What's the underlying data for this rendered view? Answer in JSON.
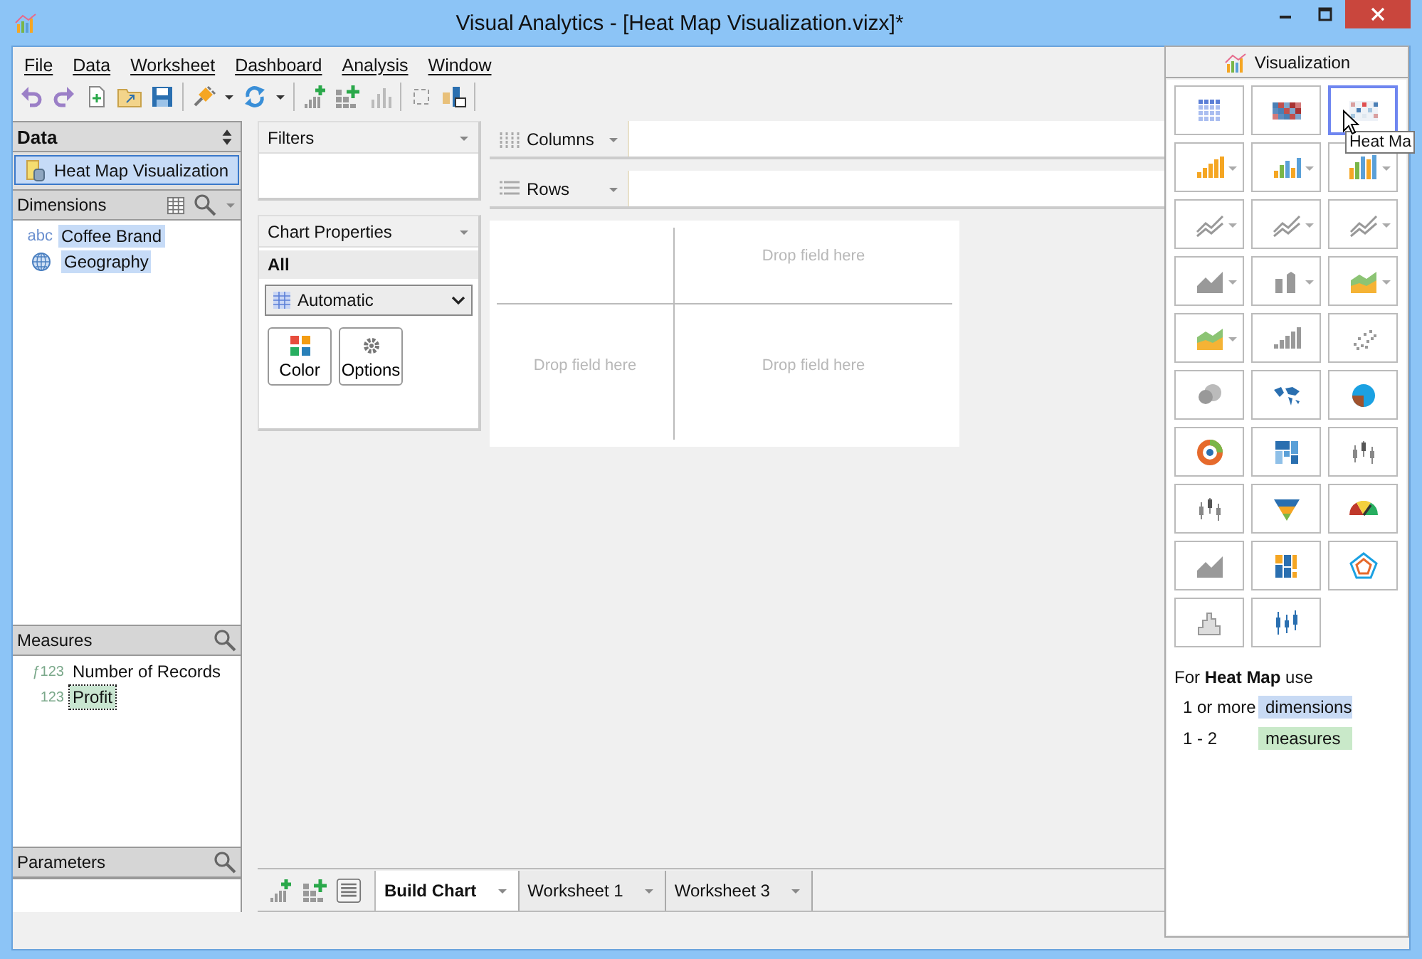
{
  "window": {
    "title": "Visual Analytics - [Heat Map Visualization.vizx]*"
  },
  "menu": [
    "File",
    "Data",
    "Worksheet",
    "Dashboard",
    "Analysis",
    "Window"
  ],
  "data_panel": {
    "title": "Data",
    "source": {
      "label": "Heat Map Visualization",
      "selected": true
    },
    "dimensions": {
      "title": "Dimensions",
      "items": [
        {
          "badge": "abc",
          "kind": "text",
          "label": "Coffee Brand",
          "selected": true
        },
        {
          "kind": "geo",
          "label": "Geography",
          "selected": true
        }
      ]
    },
    "measures": {
      "title": "Measures",
      "items": [
        {
          "badge": "ƒ123",
          "label": "Number of Records",
          "selected": false
        },
        {
          "badge": "123",
          "label": "Profit",
          "selected": true
        }
      ]
    },
    "parameters": {
      "title": "Parameters"
    }
  },
  "filters": {
    "title": "Filters"
  },
  "chart_properties": {
    "title": "Chart Properties",
    "section": "All",
    "chart_type": "Automatic",
    "buttons": [
      "Color",
      "Options"
    ]
  },
  "shelves": [
    "Columns",
    "Rows"
  ],
  "canvas": {
    "drop_hints": [
      "Drop field here",
      "Drop field here",
      "Drop field here"
    ]
  },
  "sheet_tabs": [
    {
      "label": "Build Chart",
      "selected": true
    },
    {
      "label": "Worksheet 1",
      "selected": false
    },
    {
      "label": "Worksheet 3",
      "selected": false
    }
  ],
  "visualization": {
    "title": "Visualization",
    "types": [
      {
        "kind": "table",
        "menu": false,
        "selected": false
      },
      {
        "kind": "grid",
        "menu": false,
        "selected": false
      },
      {
        "kind": "heatmap",
        "menu": false,
        "selected": true
      },
      {
        "kind": "bar",
        "menu": true,
        "selected": false
      },
      {
        "kind": "cluster",
        "menu": true,
        "selected": false
      },
      {
        "kind": "stack",
        "menu": true,
        "selected": false
      },
      {
        "kind": "line",
        "menu": true,
        "selected": false
      },
      {
        "kind": "line",
        "menu": true,
        "selected": false
      },
      {
        "kind": "line",
        "menu": true,
        "selected": false
      },
      {
        "kind": "area",
        "menu": true,
        "selected": false
      },
      {
        "kind": "step",
        "menu": true,
        "selected": false
      },
      {
        "kind": "areastack",
        "menu": true,
        "selected": false
      },
      {
        "kind": "areastack",
        "menu": true,
        "selected": false
      },
      {
        "kind": "column",
        "menu": false,
        "selected": false
      },
      {
        "kind": "scatter",
        "menu": false,
        "selected": false
      },
      {
        "kind": "bubble",
        "menu": false,
        "selected": false
      },
      {
        "kind": "map",
        "menu": false,
        "selected": false
      },
      {
        "kind": "pie",
        "menu": false,
        "selected": false
      },
      {
        "kind": "donut",
        "menu": false,
        "selected": false
      },
      {
        "kind": "treemap",
        "menu": false,
        "selected": false
      },
      {
        "kind": "candle",
        "menu": false,
        "selected": false
      },
      {
        "kind": "candle",
        "menu": false,
        "selected": false
      },
      {
        "kind": "funnel",
        "menu": false,
        "selected": false
      },
      {
        "kind": "gauge",
        "menu": false,
        "selected": false
      },
      {
        "kind": "area",
        "menu": false,
        "selected": false
      },
      {
        "kind": "mekko",
        "menu": false,
        "selected": false
      },
      {
        "kind": "radar",
        "menu": false,
        "selected": false
      },
      {
        "kind": "histogram",
        "menu": false,
        "selected": false
      },
      {
        "kind": "boxplot",
        "menu": false,
        "selected": false
      }
    ],
    "tooltip": "Heat Ma",
    "hint": "For **Heat Map** use",
    "requirements": [
      {
        "count": "1 or more",
        "label": "dimensions",
        "color": "#c8daf4"
      },
      {
        "count": "1 - 2",
        "label": "measures",
        "color": "#c9e9c9"
      }
    ]
  }
}
